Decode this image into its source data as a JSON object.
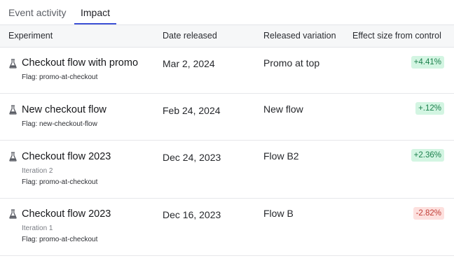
{
  "tabs": [
    {
      "label": "Event activity",
      "active": false
    },
    {
      "label": "Impact",
      "active": true
    }
  ],
  "table": {
    "headers": [
      "Experiment",
      "Date released",
      "Released variation",
      "Effect size from control"
    ],
    "rows": [
      {
        "name": "Checkout flow with promo",
        "iteration": "",
        "flag": "Flag: promo-at-checkout",
        "date": "Mar 2, 2024",
        "variation": "Promo at top",
        "effect": "+4.41%",
        "effect_sign": "positive"
      },
      {
        "name": "New checkout flow",
        "iteration": "",
        "flag": "Flag: new-checkout-flow",
        "date": "Feb 24, 2024",
        "variation": "New flow",
        "effect": "+.12%",
        "effect_sign": "positive"
      },
      {
        "name": "Checkout flow 2023",
        "iteration": "Iteration 2",
        "flag": "Flag: promo-at-checkout",
        "date": "Dec 24, 2023",
        "variation": "Flow B2",
        "effect": "+2.36%",
        "effect_sign": "positive"
      },
      {
        "name": "Checkout flow 2023",
        "iteration": "Iteration 1",
        "flag": "Flag: promo-at-checkout",
        "date": "Dec 16, 2023",
        "variation": "Flow B",
        "effect": "-2.82%",
        "effect_sign": "negative"
      }
    ]
  },
  "icons": {
    "experiment": "flask-icon"
  },
  "colors": {
    "accent": "#3d51d6",
    "positive_bg": "#d3f5e2",
    "positive_text": "#1a7f4b",
    "negative_bg": "#fde0de",
    "negative_text": "#c13c35"
  }
}
